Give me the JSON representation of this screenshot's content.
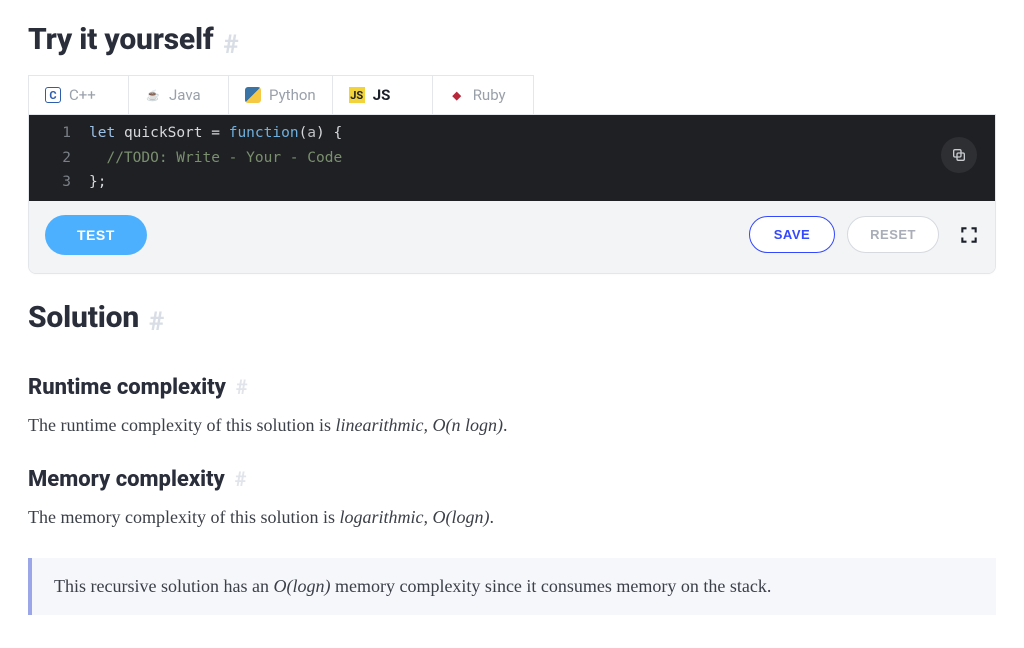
{
  "sections": {
    "try_title": "Try it yourself",
    "solution_title": "Solution",
    "runtime_title": "Runtime complexity",
    "memory_title": "Memory complexity"
  },
  "anchor_glyph": "#",
  "tabs": [
    {
      "label": "C++",
      "active": false
    },
    {
      "label": "Java",
      "active": false
    },
    {
      "label": "Python",
      "active": false
    },
    {
      "label": "JS",
      "active": true
    },
    {
      "label": "Ruby",
      "active": false
    }
  ],
  "code": {
    "lines": [
      {
        "n": "1",
        "kw1": "let",
        "var": "quickSort",
        "eq": " = ",
        "kw2": "function",
        "paren_open": "(",
        "param": "a",
        "paren_close": ")",
        "brace": " {"
      },
      {
        "n": "2",
        "comment": "//TODO: Write - Your - Code"
      },
      {
        "n": "3",
        "close": "};"
      }
    ]
  },
  "toolbar": {
    "test": "TEST",
    "save": "SAVE",
    "reset": "RESET"
  },
  "prose": {
    "runtime_pre": "The runtime complexity of this solution is ",
    "runtime_term": "linearithmic, ",
    "runtime_bigO": "O(n logn)",
    "runtime_post": ".",
    "memory_pre": "The memory complexity of this solution is ",
    "memory_term": "logarithmic, ",
    "memory_bigO": "O(logn)",
    "memory_post": ".",
    "note_pre": "This recursive solution has an ",
    "note_bigO": "O(logn)",
    "note_post": " memory complexity since it consumes memory on the stack."
  }
}
